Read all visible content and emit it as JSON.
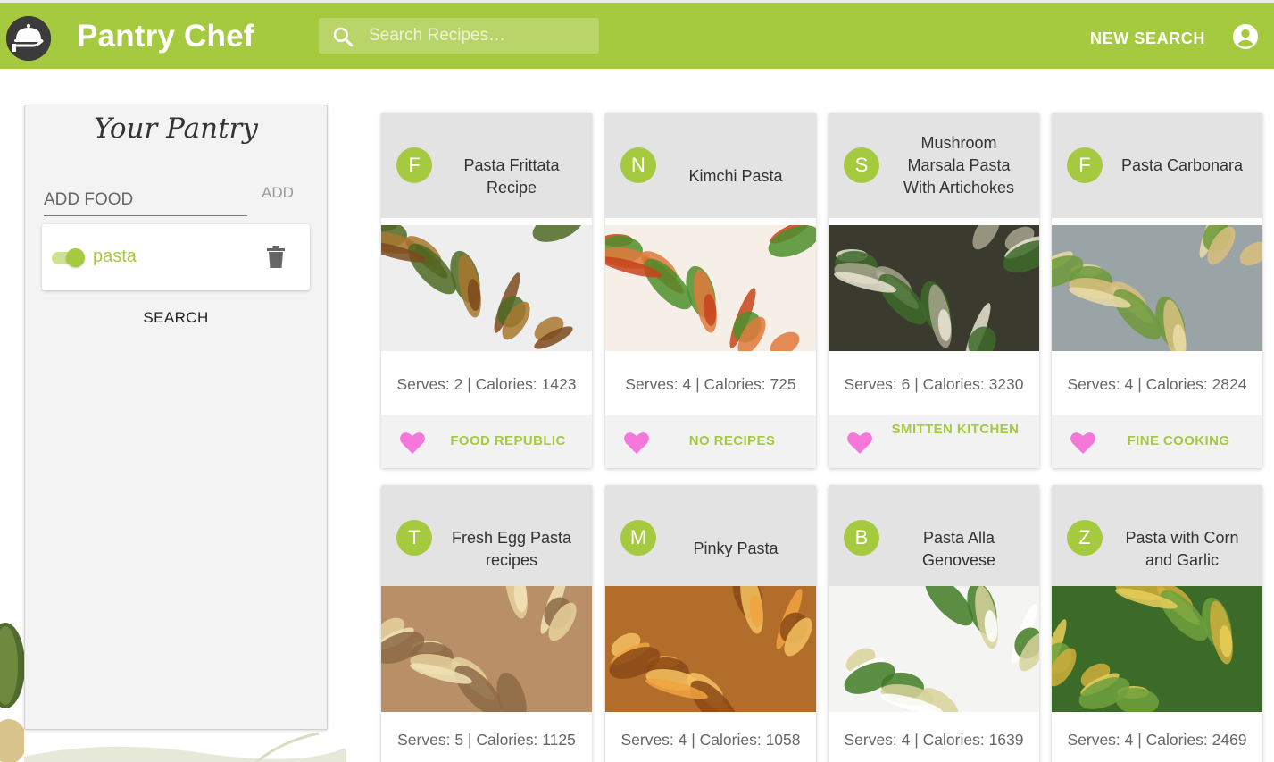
{
  "app": {
    "title": "Pantry Chef",
    "search_placeholder": "Search Recipes…",
    "new_search_label": "NEW SEARCH",
    "accent_color": "#a6ca3f",
    "icons": {
      "logo": "serving-cloche-icon",
      "search": "search-icon",
      "account": "account-circle-icon",
      "trash": "trash-icon",
      "favorite": "heart-icon"
    }
  },
  "pantry": {
    "title": "Your Pantry",
    "food_placeholder": "ADD FOOD",
    "add_label": "ADD",
    "items": [
      {
        "name": "pasta",
        "enabled": true
      }
    ],
    "search_label": "SEARCH"
  },
  "recipes": [
    {
      "initial": "F",
      "title": "Pasta Frittata Recipe",
      "serves_text": "Serves: 2 | Calories: 1423",
      "source": "FOOD REPUBLIC"
    },
    {
      "initial": "N",
      "title": "Kimchi Pasta",
      "serves_text": "Serves: 4 | Calories: 725",
      "source": "NO RECIPES"
    },
    {
      "initial": "S",
      "title": "Mushroom Marsala Pasta With Artichokes",
      "serves_text": "Serves: 6 | Calories: 3230",
      "source": "SMITTEN KITCHEN"
    },
    {
      "initial": "F",
      "title": "Pasta Carbonara",
      "serves_text": "Serves: 4 | Calories: 2824",
      "source": "FINE COOKING"
    },
    {
      "initial": "T",
      "title": "Fresh Egg Pasta recipes",
      "serves_text": "Serves: 5 | Calories: 1125",
      "source": ""
    },
    {
      "initial": "M",
      "title": "Pinky Pasta",
      "serves_text": "Serves: 4 | Calories: 1058",
      "source": ""
    },
    {
      "initial": "B",
      "title": "Pasta Alla Genovese",
      "serves_text": "Serves: 4 | Calories: 1639",
      "source": ""
    },
    {
      "initial": "Z",
      "title": "Pasta with Corn and Garlic",
      "serves_text": "Serves: 4 | Calories: 2469",
      "source": ""
    }
  ]
}
